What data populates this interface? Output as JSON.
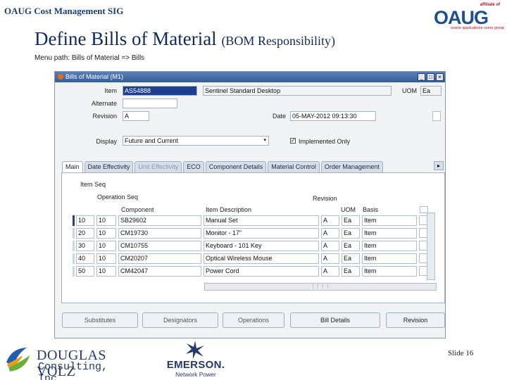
{
  "header": {
    "sig_title": "OAUG Cost Management SIG",
    "title_main": "Define Bills of Material",
    "title_sub": "(BOM Responsibility)",
    "menu_path": "Menu path: Bills of Material => Bills"
  },
  "oaug_logo": {
    "affiliate": "affiliate of",
    "wordmark": "OAUG",
    "tagline": "oracle applications users group"
  },
  "window": {
    "title": "Bills of Material (M1)",
    "controls": [
      "_",
      "□",
      "×"
    ]
  },
  "form": {
    "item_label": "Item",
    "item_value": "AS54888",
    "item_desc": "Sentinel Standard Desktop",
    "uom_label": "UOM",
    "uom_value": "Ea",
    "alternate_label": "Alternate",
    "alternate_value": "",
    "revision_label": "Revision",
    "revision_value": "A",
    "date_label": "Date",
    "date_value": "05-MAY-2012 09:13:30",
    "display_label": "Display",
    "display_value": "Future and Current",
    "implemented_only_label": "Implemented Only",
    "implemented_only_checked": true
  },
  "tabs": [
    {
      "label": "Main",
      "active": true,
      "disabled": false
    },
    {
      "label": "Date Effectivity",
      "active": false,
      "disabled": false
    },
    {
      "label": "Unit Effectivity",
      "active": false,
      "disabled": true
    },
    {
      "label": "ECO",
      "active": false,
      "disabled": false
    },
    {
      "label": "Component Details",
      "active": false,
      "disabled": false
    },
    {
      "label": "Material Control",
      "active": false,
      "disabled": false
    },
    {
      "label": "Order Management",
      "active": false,
      "disabled": false
    }
  ],
  "table": {
    "item_seq_header": "Item Seq",
    "op_seq_header": "Operation Seq",
    "component_header": "Component",
    "item_desc_header": "Item Description",
    "revision_header": "Revision",
    "uom_header": "UOM",
    "basis_header": "Basis",
    "rows": [
      {
        "item_seq": "10",
        "op_seq": "10",
        "component": "SB29602",
        "description": "Manual Set",
        "revision": "A",
        "uom": "Ea",
        "basis": "Item"
      },
      {
        "item_seq": "20",
        "op_seq": "10",
        "component": "CM19730",
        "description": "Monitor - 17\"",
        "revision": "A",
        "uom": "Ea",
        "basis": "Item"
      },
      {
        "item_seq": "30",
        "op_seq": "10",
        "component": "CM10755",
        "description": "Keyboard - 101 Key",
        "revision": "A",
        "uom": "Ea",
        "basis": "Item"
      },
      {
        "item_seq": "40",
        "op_seq": "10",
        "component": "CM20207",
        "description": "Optical Wireless Mouse",
        "revision": "A",
        "uom": "Ea",
        "basis": "Item"
      },
      {
        "item_seq": "50",
        "op_seq": "10",
        "component": "CM42047",
        "description": "Power Cord",
        "revision": "A",
        "uom": "Ea",
        "basis": "Item"
      }
    ]
  },
  "buttons": {
    "substitutes": "Substitutes",
    "designators": "Designators",
    "operations": "Operations",
    "bill_details": "Bill Details",
    "revision": "Revision"
  },
  "footer": {
    "dv_line1": "DOUGLAS VOLZ",
    "dv_line2": "Consulting, Inc.",
    "emerson_word": "EMERSON.",
    "emerson_sub": "Network Power",
    "slide_label": "Slide 16"
  },
  "colors": {
    "title_blue": "#102a5c",
    "selected_field": "#1c3f8f",
    "window_titlebar": "#345d99"
  }
}
